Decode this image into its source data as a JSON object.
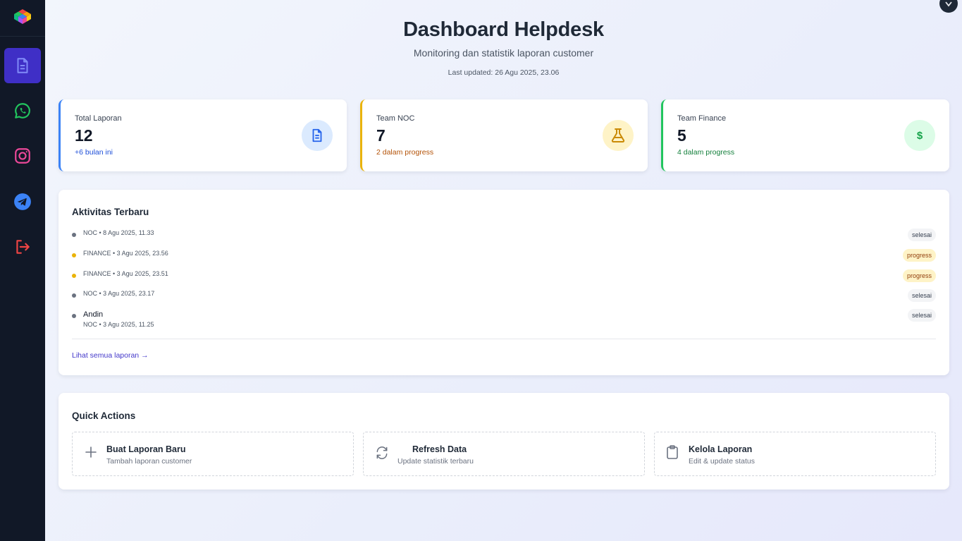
{
  "sidebar": {
    "items": [
      {
        "icon": "document-icon",
        "active": true
      },
      {
        "icon": "whatsapp-icon"
      },
      {
        "icon": "instagram-icon"
      },
      {
        "icon": "telegram-icon"
      },
      {
        "icon": "logout-icon"
      }
    ]
  },
  "header": {
    "title": "Dashboard Helpdesk",
    "subtitle": "Monitoring dan statistik laporan customer",
    "last_updated": "Last updated: 26 Agu 2025, 23.06"
  },
  "stats": [
    {
      "label": "Total Laporan",
      "value": "12",
      "sub": "+6 bulan ini",
      "accent": "#3b82f6",
      "sub_color": "#1d4ed8",
      "icon": "document-icon"
    },
    {
      "label": "Team NOC",
      "value": "7",
      "sub": "2 dalam progress",
      "accent": "#eab308",
      "sub_color": "#b45309",
      "icon": "flask-icon"
    },
    {
      "label": "Team Finance",
      "value": "5",
      "sub": "4 dalam progress",
      "accent": "#22c55e",
      "sub_color": "#15803d",
      "icon": "dollar-icon"
    }
  ],
  "activity": {
    "title": "Aktivitas Terbaru",
    "items": [
      {
        "name": "",
        "meta": "NOC • 8 Agu 2025, 11.33",
        "status": "selesai"
      },
      {
        "name": "",
        "meta": "FINANCE • 3 Agu 2025, 23.56",
        "status": "progress"
      },
      {
        "name": "",
        "meta": "FINANCE • 3 Agu 2025, 23.51",
        "status": "progress"
      },
      {
        "name": "",
        "meta": "NOC • 3 Agu 2025, 23.17",
        "status": "selesai"
      },
      {
        "name": "Andin",
        "meta": "NOC • 3 Agu 2025, 11.25",
        "status": "selesai"
      }
    ],
    "see_all": "Lihat semua laporan →"
  },
  "quick_actions": {
    "title": "Quick Actions",
    "items": [
      {
        "title": "Buat Laporan Baru",
        "desc": "Tambah laporan customer",
        "icon": "plus-icon"
      },
      {
        "title": "Refresh Data",
        "desc": "Update statistik terbaru",
        "icon": "refresh-icon"
      },
      {
        "title": "Kelola Laporan",
        "desc": "Edit & update status",
        "icon": "clipboard-icon"
      }
    ]
  },
  "colors": {
    "sidebar_bg": "#111827",
    "active_nav": "#3f2fc6",
    "progress_dot": "#eab308",
    "done_dot": "#6b7280"
  }
}
